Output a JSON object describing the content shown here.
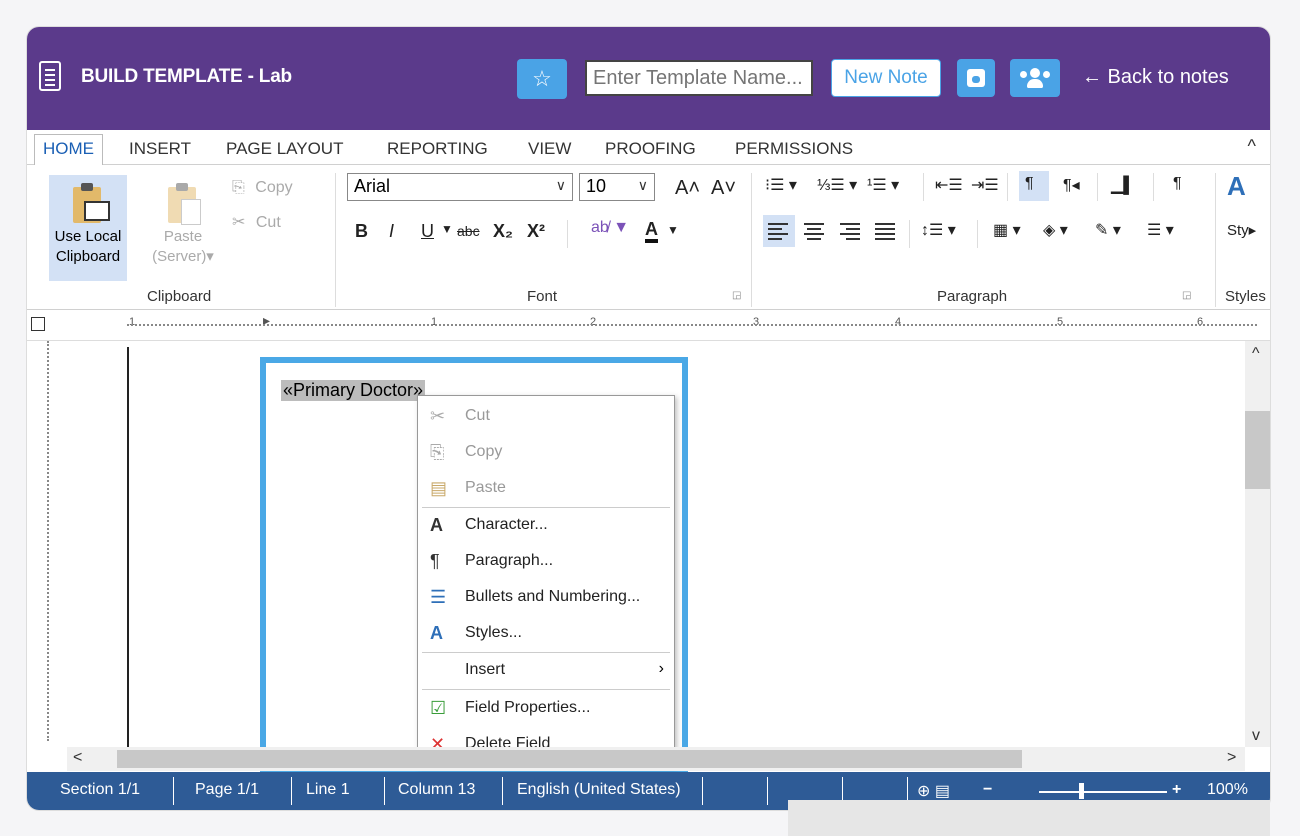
{
  "header": {
    "title": "BUILD TEMPLATE - Lab",
    "template_name_placeholder": "Enter Template Name...",
    "new_note": "New Note",
    "back": "← Back to notes",
    "star": "☆"
  },
  "ribbon_tabs": [
    "HOME",
    "INSERT",
    "PAGE LAYOUT",
    "REPORTING",
    "VIEW",
    "PROOFING",
    "PERMISSIONS"
  ],
  "collapse": "^",
  "clipboard": {
    "use_local": "Use Local",
    "use_local2": "Clipboard",
    "paste": "Paste",
    "paste2": "(Server)▾",
    "copy": "Copy",
    "cut": "Cut",
    "group": "Clipboard"
  },
  "font": {
    "name": "Arial",
    "size": "10",
    "group": "Font",
    "bold": "B",
    "italic": "I",
    "underline": "U",
    "strike": "abc",
    "sub": "X₂",
    "sup": "X²",
    "grow": "A˄",
    "shrink": "A˅"
  },
  "paragraph": {
    "group": "Paragraph"
  },
  "styles": {
    "group": "Styles",
    "label": "Styles"
  },
  "ruler": {
    "marks": [
      "1",
      "1",
      "2",
      "3",
      "4",
      "5",
      "6"
    ]
  },
  "document": {
    "field": "«Primary Doctor»"
  },
  "context_menu": {
    "cut": "Cut",
    "copy": "Copy",
    "paste": "Paste",
    "character": "Character...",
    "paragraph": "Paragraph...",
    "bullets": "Bullets and Numbering...",
    "styles": "Styles...",
    "insert": "Insert",
    "field_properties": "Field Properties...",
    "delete_field": "Delete Field"
  },
  "status": {
    "section": "Section 1/1",
    "page": "Page 1/1",
    "line": "Line 1",
    "column": "Column 13",
    "language": "English (United States)",
    "zoom": "100%",
    "minus": "−",
    "plus": "+"
  },
  "colors": {
    "header": "#5b3a8b",
    "accent": "#4aa3e6",
    "status": "#2e5b96",
    "field_border": "#4aa8e6"
  }
}
